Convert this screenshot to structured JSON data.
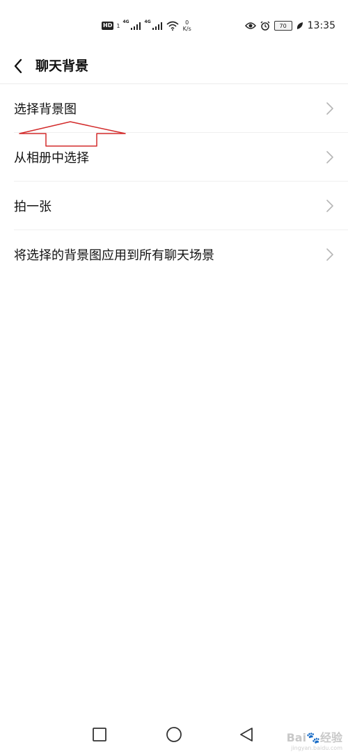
{
  "status_bar": {
    "hd_badge": "HD",
    "sim1_network": "4G",
    "sim2_network": "4G",
    "sim_number": "1",
    "speed_value": "0",
    "speed_unit": "K/s",
    "battery": "70",
    "time": "13:35"
  },
  "header": {
    "title": "聊天背景"
  },
  "menu_items": [
    {
      "label": "选择背景图"
    },
    {
      "label": "从相册中选择"
    },
    {
      "label": "拍一张"
    },
    {
      "label": "将选择的背景图应用到所有聊天场景"
    }
  ],
  "annotation": {
    "color": "#d32b2b"
  },
  "watermark": {
    "text": "Bai🐾经验",
    "subtext": "jingyan.baidu.com"
  },
  "colors": {
    "text": "#111111",
    "chevron": "#b5b5b5",
    "divider": "#efefef"
  }
}
